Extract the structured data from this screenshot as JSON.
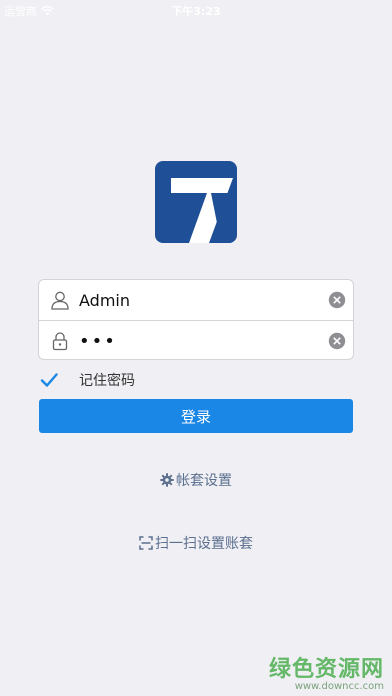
{
  "status_bar": {
    "carrier": "运营商",
    "time": "下午3:23"
  },
  "login": {
    "username_value": "Admin",
    "password_value": "•••",
    "remember_label": "记住密码",
    "remember_checked": true,
    "submit_label": "登录"
  },
  "links": {
    "account_settings": "帐套设置",
    "scan_settings": "扫一扫设置账套"
  },
  "watermark": {
    "title": "绿色资源网",
    "url": "www.downcc.com"
  },
  "colors": {
    "background": "#efeff4",
    "accent": "#1a86e6",
    "logo_blue": "#1e4f97",
    "link": "#5b6f8e",
    "watermark_green": "#4caf50"
  },
  "icons": {
    "user": "user-icon",
    "lock": "lock-icon",
    "clear": "clear-icon",
    "check": "check-icon",
    "gear": "gear-icon",
    "scan": "scan-icon",
    "wifi": "wifi-icon"
  }
}
